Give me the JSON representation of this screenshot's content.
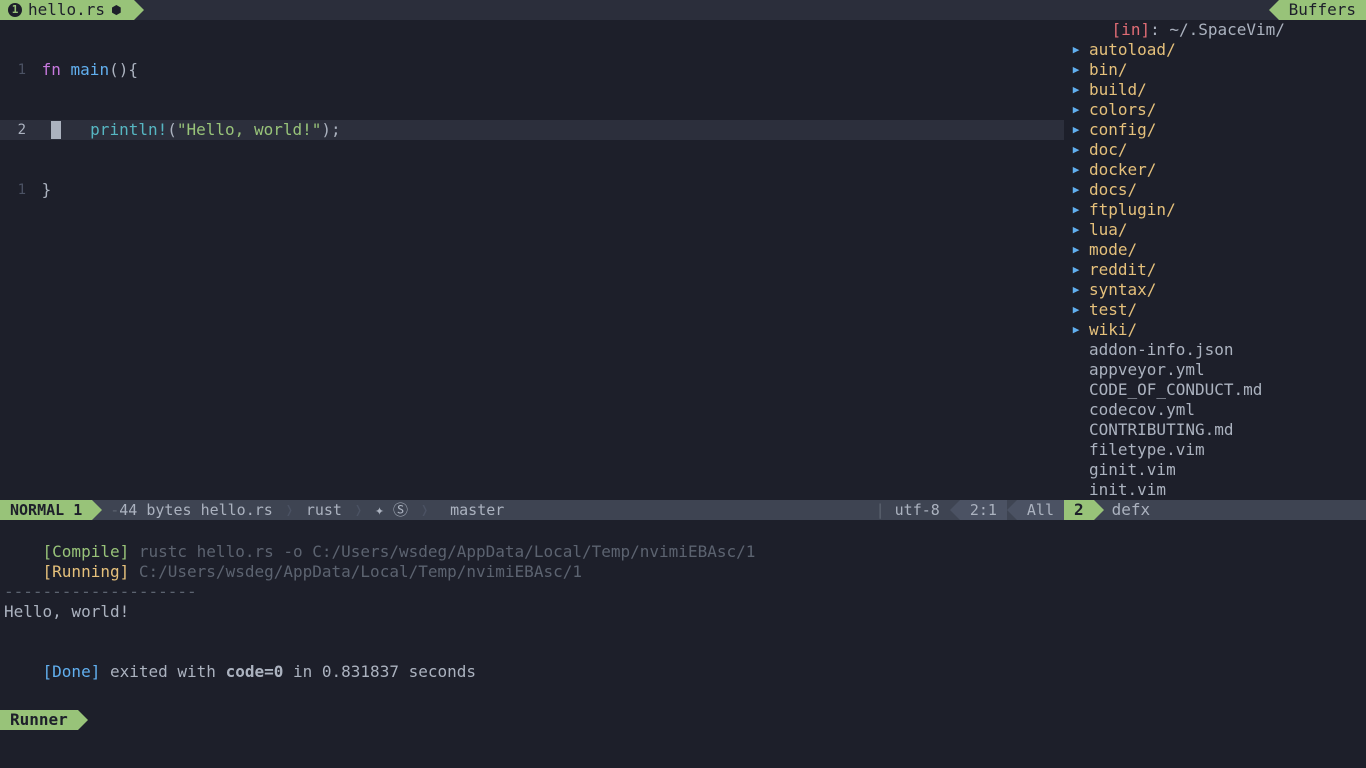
{
  "tabbar": {
    "tab_number": "1",
    "tab_file": "hello.rs",
    "tab_modified": "⬢",
    "buffers_label": "Buffers"
  },
  "code": {
    "l1_gutter": "1",
    "l1_fn": "fn",
    "l1_name": " main",
    "l1_rest": "(){",
    "l2_gutter": "2",
    "l2_macro": "println!",
    "l2_open": "(",
    "l2_str": "\"Hello, world!\"",
    "l2_close": ");",
    "l3_gutter": "1",
    "l3_text": "}"
  },
  "status": {
    "mode": "NORMAL",
    "mode_n": "1",
    "size": "44 bytes",
    "filename": "hello.rs",
    "filetype": "rust",
    "checker": "✦ Ⓢ",
    "branch_icon": "",
    "branch": "master",
    "os_icon": "",
    "encoding": "utf-8",
    "pos": "2:1",
    "percent": "All"
  },
  "defx_status": {
    "num": "2",
    "name": "defx"
  },
  "tree": {
    "in_label": "[in]",
    "path": ": ~/.SpaceVim/",
    "dirs": [
      "autoload/",
      "bin/",
      "build/",
      "colors/",
      "config/",
      "doc/",
      "docker/",
      "docs/",
      "ftplugin/",
      "lua/",
      "mode/",
      "reddit/",
      "syntax/",
      "test/",
      "wiki/"
    ],
    "files": [
      "addon-info.json",
      "appveyor.yml",
      "CODE_OF_CONDUCT.md",
      "codecov.yml",
      "CONTRIBUTING.md",
      "filetype.vim",
      "ginit.vim",
      "init.vim"
    ]
  },
  "runner": {
    "compile_tag": "[Compile]",
    "compile_cmd": " rustc hello.rs -o C:/Users/wsdeg/AppData/Local/Temp/nvimiEBAsc/1",
    "running_tag": "[Running]",
    "running_cmd": " C:/Users/wsdeg/AppData/Local/Temp/nvimiEBAsc/1",
    "sep": "--------------------",
    "output": "Hello, world!",
    "done_tag": "[Done]",
    "done_pre": " exited with ",
    "done_code": "code=0",
    "done_post": " in 0.831837 seconds",
    "tab_label": "Runner"
  }
}
